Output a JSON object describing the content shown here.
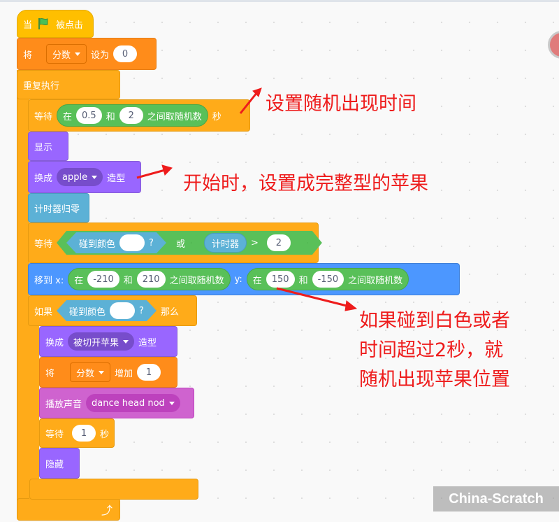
{
  "script": {
    "when_flag": {
      "prefix": "当",
      "icon": "green-flag-icon",
      "suffix": "被点击"
    },
    "set_var": {
      "label": "将",
      "variable": "分数",
      "middle": "设为",
      "value": "0"
    },
    "forever": {
      "label": "重复执行",
      "icon": "loop-arrow-icon"
    },
    "wait_random": {
      "label": "等待",
      "in": "在",
      "from": "0.5",
      "and": "和",
      "to": "2",
      "pick": "之间取随机数",
      "unit": "秒"
    },
    "show": {
      "label": "显示"
    },
    "switch_costume_1": {
      "label": "换成",
      "costume": "apple",
      "suffix": "造型"
    },
    "reset_timer": {
      "label": "计时器归零"
    },
    "wait_until": {
      "label": "等待",
      "touching": "碰到颜色",
      "q": "?",
      "or": "或",
      "timer": "计时器",
      "gt": ">",
      "value": "2"
    },
    "goto_xy": {
      "label": "移到 x:",
      "in1": "在",
      "x_from": "-210",
      "and1": "和",
      "x_to": "210",
      "pick1": "之间取随机数",
      "y_label": "y:",
      "in2": "在",
      "y_from": "150",
      "and2": "和",
      "y_to": "-150",
      "pick2": "之间取随机数"
    },
    "if_block": {
      "label": "如果",
      "touching": "碰到颜色",
      "q": "?",
      "then": "那么"
    },
    "switch_costume_2": {
      "label": "换成",
      "costume": "被切开苹果",
      "suffix": "造型"
    },
    "change_var": {
      "label": "将",
      "variable": "分数",
      "middle": "增加",
      "value": "1"
    },
    "play_sound": {
      "label": "播放声音",
      "sound": "dance head nod"
    },
    "wait_1": {
      "label": "等待",
      "value": "1",
      "unit": "秒"
    },
    "hide": {
      "label": "隐藏"
    }
  },
  "annotations": {
    "note1": "设置随机出现时间",
    "note2": "开始时，设置成完整型的苹果",
    "note3": [
      "如果碰到白色或者",
      "时间超过2秒，就",
      "随机出现苹果位置"
    ]
  },
  "watermark": "China-Scratch",
  "colors": {
    "annotation": "#ee1c1c",
    "events": "#ffbf00",
    "control": "#ffab19",
    "variables": "#ff8c1a",
    "looks": "#9966ff",
    "sensing": "#5cb1d6",
    "motion": "#4c97ff",
    "sound": "#cf63cf",
    "operators": "#59c059"
  }
}
